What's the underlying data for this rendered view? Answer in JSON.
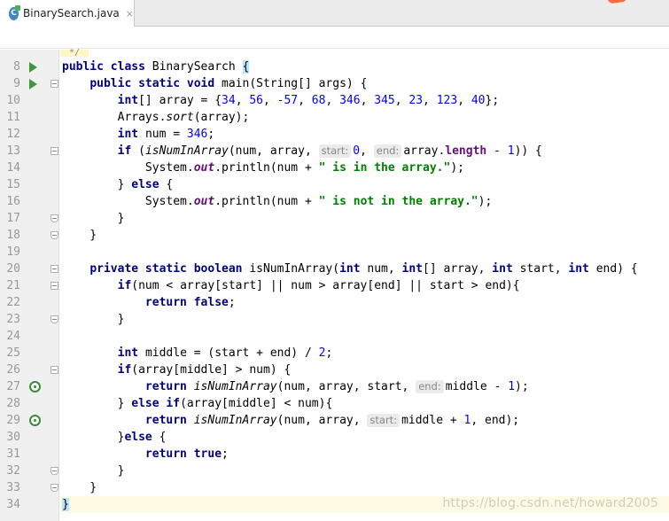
{
  "tab": {
    "icon_letter": "C",
    "filename": "BinarySearch.java",
    "close_glyph": "×"
  },
  "folded_marker": "*/",
  "watermark": "https://blog.csdn.net/howard2005",
  "colors": {
    "keyword": "#000080",
    "number": "#0000ff",
    "string": "#008000",
    "field": "#660e7a"
  },
  "lines": [
    {
      "n": "8",
      "gutter": "run",
      "fold": "",
      "current": false,
      "tokens": [
        [
          "kw",
          "public class "
        ],
        [
          "",
          "BinarySearch "
        ],
        [
          "brace",
          "{"
        ]
      ]
    },
    {
      "n": "9",
      "gutter": "run",
      "fold": "fold",
      "current": false,
      "tokens": [
        [
          "",
          "    "
        ],
        [
          "kw",
          "public static void "
        ],
        [
          "",
          "main(String[] args) {"
        ]
      ]
    },
    {
      "n": "10",
      "gutter": "",
      "fold": "",
      "current": false,
      "tokens": [
        [
          "",
          "        "
        ],
        [
          "kw",
          "int"
        ],
        [
          "",
          "[] array = {"
        ],
        [
          "num",
          "34"
        ],
        [
          "",
          ", "
        ],
        [
          "num",
          "56"
        ],
        [
          "",
          ", "
        ],
        [
          "num",
          "-57"
        ],
        [
          "",
          ", "
        ],
        [
          "num",
          "68"
        ],
        [
          "",
          ", "
        ],
        [
          "num",
          "346"
        ],
        [
          "",
          ", "
        ],
        [
          "num",
          "345"
        ],
        [
          "",
          ", "
        ],
        [
          "num",
          "23"
        ],
        [
          "",
          ", "
        ],
        [
          "num",
          "123"
        ],
        [
          "",
          ", "
        ],
        [
          "num",
          "40"
        ],
        [
          "",
          "};"
        ]
      ]
    },
    {
      "n": "11",
      "gutter": "",
      "fold": "",
      "current": false,
      "tokens": [
        [
          "",
          "        Arrays."
        ],
        [
          "it",
          "sort"
        ],
        [
          "",
          "(array);"
        ]
      ]
    },
    {
      "n": "12",
      "gutter": "",
      "fold": "",
      "current": false,
      "tokens": [
        [
          "",
          "        "
        ],
        [
          "kw",
          "int "
        ],
        [
          "",
          "num = "
        ],
        [
          "num",
          "346"
        ],
        [
          "",
          ";"
        ]
      ]
    },
    {
      "n": "13",
      "gutter": "",
      "fold": "fold",
      "current": false,
      "tokens": [
        [
          "",
          "        "
        ],
        [
          "kw",
          "if "
        ],
        [
          "",
          "("
        ],
        [
          "it",
          "isNumInArray"
        ],
        [
          "",
          "(num, array, "
        ],
        [
          "hint",
          "start:"
        ],
        [
          "num",
          "0"
        ],
        [
          "",
          ", "
        ],
        [
          "hint",
          "end:"
        ],
        [
          "",
          "array."
        ],
        [
          "mbr",
          "length"
        ],
        [
          "",
          " - "
        ],
        [
          "num",
          "1"
        ],
        [
          "",
          "))"
        ],
        [
          "",
          " {"
        ]
      ]
    },
    {
      "n": "14",
      "gutter": "",
      "fold": "",
      "current": false,
      "tokens": [
        [
          "",
          "            System."
        ],
        [
          "fld",
          "out"
        ],
        [
          "",
          ".println(num + "
        ],
        [
          "str",
          "\" is in the array.\""
        ],
        [
          "",
          ");"
        ]
      ]
    },
    {
      "n": "15",
      "gutter": "",
      "fold": "",
      "current": false,
      "tokens": [
        [
          "",
          "        } "
        ],
        [
          "kw",
          "else "
        ],
        [
          "",
          "{"
        ]
      ]
    },
    {
      "n": "16",
      "gutter": "",
      "fold": "",
      "current": false,
      "tokens": [
        [
          "",
          "            System."
        ],
        [
          "fld",
          "out"
        ],
        [
          "",
          ".println(num + "
        ],
        [
          "str",
          "\" is not in the array.\""
        ],
        [
          "",
          ");"
        ]
      ]
    },
    {
      "n": "17",
      "gutter": "",
      "fold": "end",
      "current": false,
      "tokens": [
        [
          "",
          "        }"
        ]
      ]
    },
    {
      "n": "18",
      "gutter": "",
      "fold": "end",
      "current": false,
      "tokens": [
        [
          "",
          "    }"
        ]
      ]
    },
    {
      "n": "19",
      "gutter": "",
      "fold": "",
      "current": false,
      "tokens": []
    },
    {
      "n": "20",
      "gutter": "",
      "fold": "fold",
      "current": false,
      "tokens": [
        [
          "",
          "    "
        ],
        [
          "kw",
          "private static boolean "
        ],
        [
          "",
          "isNumInArray("
        ],
        [
          "kw",
          "int "
        ],
        [
          "",
          "num, "
        ],
        [
          "kw",
          "int"
        ],
        [
          "",
          "[] array, "
        ],
        [
          "kw",
          "int "
        ],
        [
          "",
          "start, "
        ],
        [
          "kw",
          "int "
        ],
        [
          "",
          "end) {"
        ]
      ]
    },
    {
      "n": "21",
      "gutter": "",
      "fold": "fold",
      "current": false,
      "tokens": [
        [
          "",
          "        "
        ],
        [
          "kw",
          "if"
        ],
        [
          "",
          "(num < array[start] || num > array[end] || start > end){"
        ]
      ]
    },
    {
      "n": "22",
      "gutter": "",
      "fold": "",
      "current": false,
      "tokens": [
        [
          "",
          "            "
        ],
        [
          "kw",
          "return false"
        ],
        [
          "",
          ";"
        ]
      ]
    },
    {
      "n": "23",
      "gutter": "",
      "fold": "end",
      "current": false,
      "tokens": [
        [
          "",
          "        }"
        ]
      ]
    },
    {
      "n": "24",
      "gutter": "",
      "fold": "",
      "current": false,
      "tokens": []
    },
    {
      "n": "25",
      "gutter": "",
      "fold": "",
      "current": false,
      "tokens": [
        [
          "",
          "        "
        ],
        [
          "kw",
          "int "
        ],
        [
          "",
          "middle = (start + end) / "
        ],
        [
          "num",
          "2"
        ],
        [
          "",
          ";"
        ]
      ]
    },
    {
      "n": "26",
      "gutter": "",
      "fold": "fold",
      "current": false,
      "tokens": [
        [
          "",
          "        "
        ],
        [
          "kw",
          "if"
        ],
        [
          "",
          "(array[middle] > num) {"
        ]
      ]
    },
    {
      "n": "27",
      "gutter": "recur",
      "fold": "",
      "current": false,
      "tokens": [
        [
          "",
          "            "
        ],
        [
          "kw",
          "return "
        ],
        [
          "it",
          "isNumInArray"
        ],
        [
          "",
          "(num, array, start, "
        ],
        [
          "hint",
          "end:"
        ],
        [
          "",
          "middle - "
        ],
        [
          "num",
          "1"
        ],
        [
          "",
          ");"
        ]
      ]
    },
    {
      "n": "28",
      "gutter": "",
      "fold": "",
      "current": false,
      "tokens": [
        [
          "",
          "        } "
        ],
        [
          "kw",
          "else if"
        ],
        [
          "",
          "(array[middle] < num){"
        ]
      ]
    },
    {
      "n": "29",
      "gutter": "recur",
      "fold": "",
      "current": false,
      "tokens": [
        [
          "",
          "            "
        ],
        [
          "kw",
          "return "
        ],
        [
          "it",
          "isNumInArray"
        ],
        [
          "",
          "(num, array, "
        ],
        [
          "hint",
          "start:"
        ],
        [
          "",
          "middle + "
        ],
        [
          "num",
          "1"
        ],
        [
          "",
          ", end);"
        ]
      ]
    },
    {
      "n": "30",
      "gutter": "",
      "fold": "",
      "current": false,
      "tokens": [
        [
          "",
          "        }"
        ],
        [
          "kw",
          "else "
        ],
        [
          "",
          "{"
        ]
      ]
    },
    {
      "n": "31",
      "gutter": "",
      "fold": "",
      "current": false,
      "tokens": [
        [
          "",
          "            "
        ],
        [
          "kw",
          "return true"
        ],
        [
          "",
          ";"
        ]
      ]
    },
    {
      "n": "32",
      "gutter": "",
      "fold": "end",
      "current": false,
      "tokens": [
        [
          "",
          "        }"
        ]
      ]
    },
    {
      "n": "33",
      "gutter": "",
      "fold": "end",
      "current": false,
      "tokens": [
        [
          "",
          "    }"
        ]
      ]
    },
    {
      "n": "34",
      "gutter": "",
      "fold": "",
      "current": true,
      "tokens": [
        [
          "brace",
          "}"
        ]
      ]
    }
  ]
}
